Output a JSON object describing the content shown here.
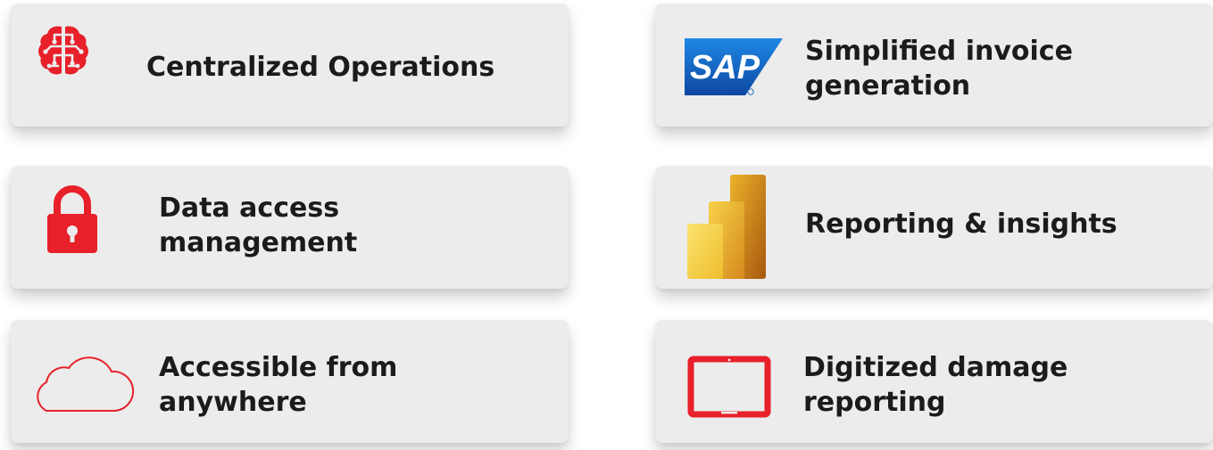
{
  "features": [
    {
      "lines": [
        "Centralized Operations"
      ],
      "icon": "brain-circuit-icon"
    },
    {
      "lines": [
        "Simplified invoice",
        "generation"
      ],
      "icon": "sap-logo-icon",
      "logo_text": "SAP"
    },
    {
      "lines": [
        "Data access",
        "management"
      ],
      "icon": "lock-icon"
    },
    {
      "lines": [
        "Reporting & insights"
      ],
      "icon": "power-bi-icon"
    },
    {
      "lines": [
        "Accessible from",
        "anywhere"
      ],
      "icon": "cloud-icon"
    },
    {
      "lines": [
        "Digitized damage",
        "reporting"
      ],
      "icon": "tablet-icon"
    }
  ],
  "colors": {
    "accent_red": "#e8202a",
    "sap_blue": "#1565c0",
    "text": "#1b1b1b",
    "card_bg": "#ececec",
    "powerbi_light": "#f2c811",
    "powerbi_dark": "#c8791a"
  }
}
